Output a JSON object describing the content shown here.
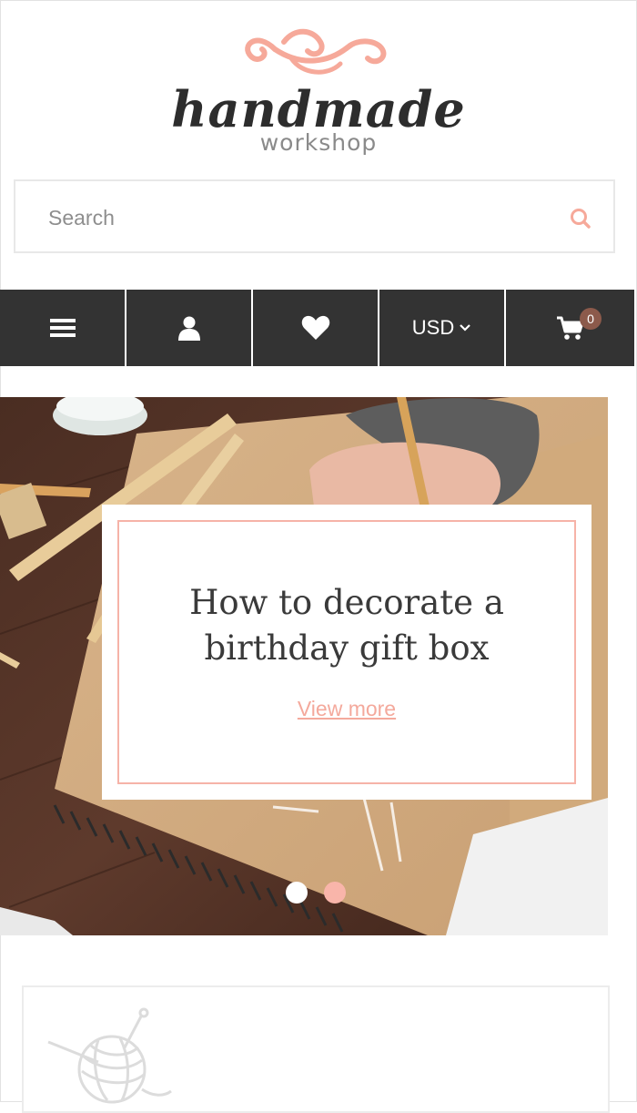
{
  "logo": {
    "word": "handmade",
    "subtitle": "workshop",
    "accent": "#f6a99a"
  },
  "search": {
    "placeholder": "Search",
    "icon": "search-icon"
  },
  "nav": {
    "menu_icon": "menu-icon",
    "user_icon": "user-icon",
    "wishlist_icon": "heart-icon",
    "currency": "USD",
    "cart_icon": "cart-icon",
    "cart_count": "0",
    "background": "#333333"
  },
  "slider": {
    "title": "How to decorate a birthday gift box",
    "link_label": "View more",
    "active_dot": 1,
    "dot_count": 2
  },
  "feature": {
    "icon": "yarn-ball-icon"
  }
}
